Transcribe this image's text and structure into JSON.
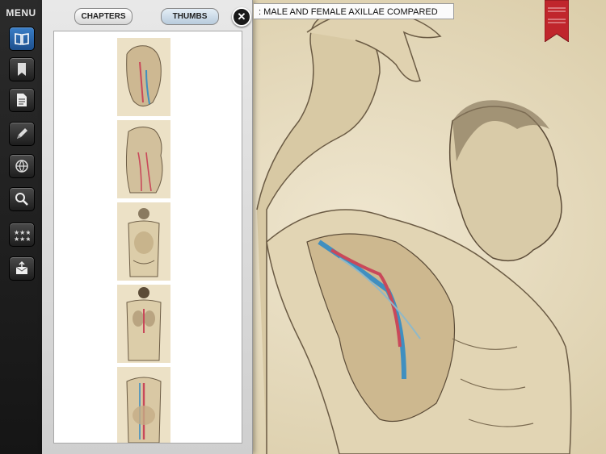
{
  "menu": {
    "title": "MENU",
    "items": [
      {
        "name": "book-icon",
        "active": true
      },
      {
        "name": "bookmark-icon",
        "active": false
      },
      {
        "name": "document-icon",
        "active": false
      },
      {
        "name": "pencil-icon",
        "active": false
      },
      {
        "name": "globe-icon",
        "active": false
      },
      {
        "name": "search-icon",
        "active": false
      },
      {
        "name": "stars-icon",
        "active": false
      },
      {
        "name": "share-icon",
        "active": false
      }
    ]
  },
  "panel": {
    "chapters_label": "CHAPTERS",
    "thumbs_label": "THUMBS",
    "close_label": "✕"
  },
  "title_bar": {
    "text": ": MALE AND FEMALE AXILLAE COMPARED"
  },
  "colors": {
    "accent": "#3a7fc8",
    "ribbon": "#c0262c",
    "paper": "#e9dfc4"
  }
}
